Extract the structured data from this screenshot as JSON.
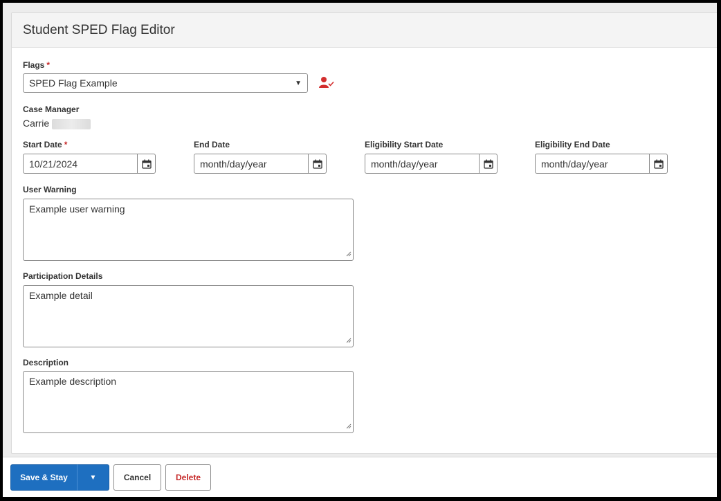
{
  "editor": {
    "title": "Student SPED Flag Editor"
  },
  "flags": {
    "label": "Flags",
    "required_mark": "*",
    "selected": "SPED Flag Example",
    "icon": "user-check-icon",
    "icon_color": "#d32f2f"
  },
  "case_manager": {
    "label": "Case Manager",
    "value": "Carrie"
  },
  "dates": [
    {
      "label": "Start Date",
      "required_mark": "*",
      "value": "10/21/2024"
    },
    {
      "label": "End Date",
      "required_mark": "",
      "value": "month/day/year"
    },
    {
      "label": "Eligibility Start Date",
      "required_mark": "",
      "value": "month/day/year"
    },
    {
      "label": "Eligibility End Date",
      "required_mark": "",
      "value": "month/day/year"
    }
  ],
  "user_warning": {
    "label": "User Warning",
    "value": "Example user warning"
  },
  "participation_details": {
    "label": "Participation Details",
    "value": "Example detail"
  },
  "description": {
    "label": "Description",
    "value": "Example description"
  },
  "footer": {
    "save_stay": "Save & Stay",
    "cancel": "Cancel",
    "delete": "Delete"
  },
  "colors": {
    "primary": "#1e6fc0",
    "danger": "#c62828"
  }
}
